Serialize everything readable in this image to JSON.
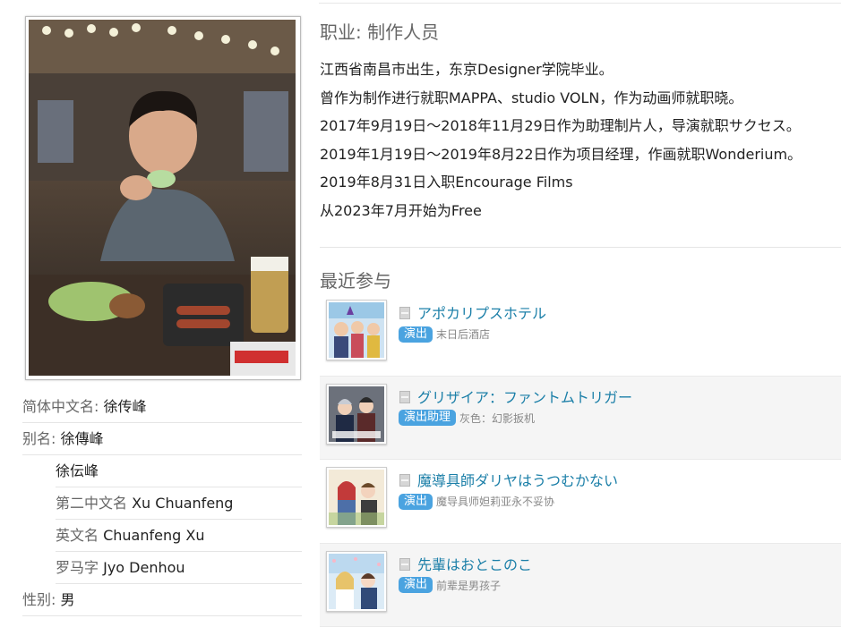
{
  "profile": {
    "photo_alt": "person-photo",
    "info": [
      {
        "key": "简体中文名: ",
        "value": "徐传峰",
        "sub": false
      },
      {
        "key": "别名: ",
        "value": "徐傳峰",
        "sub": false
      },
      {
        "key": "",
        "value": "徐伝峰",
        "sub": true
      },
      {
        "key": "第二中文名 ",
        "value": "Xu Chuanfeng",
        "sub": true
      },
      {
        "key": "英文名 ",
        "value": "Chuanfeng Xu",
        "sub": true
      },
      {
        "key": "罗马字 ",
        "value": "Jyo Denhou",
        "sub": true
      },
      {
        "key": "性别: ",
        "value": "男",
        "sub": false
      }
    ]
  },
  "job": "职业: 制作人员",
  "bio": [
    "江西省南昌市出生，东京Designer学院毕业。",
    "曾作为制作进行就职MAPPA、studio VOLN，作为动画师就职晓。",
    "2017年9月19日～2018年11月29日作为助理制片人，导演就职サクセス。",
    "2019年1月19日～2019年8月22日作为项目经理，作画就职Wonderium。",
    "2019年8月31日入职Encourage Films",
    "从2023年7月开始为Free"
  ],
  "recent_title": "最近参与",
  "works": [
    {
      "title": "アポカリプスホテル",
      "role": "演出",
      "cn": "末日后酒店"
    },
    {
      "title": "グリザイア：ファントムトリガー",
      "role": "演出助理",
      "cn": "灰色：幻影扳机"
    },
    {
      "title": "魔導具師ダリヤはうつむかない",
      "role": "演出",
      "cn": "魔导具师妲莉亚永不妥协"
    },
    {
      "title": "先輩はおとこのこ",
      "role": "演出",
      "cn": "前辈是男孩子"
    }
  ],
  "colors": {
    "link": "#1b7fa8",
    "badge": "#4aa3e0"
  }
}
